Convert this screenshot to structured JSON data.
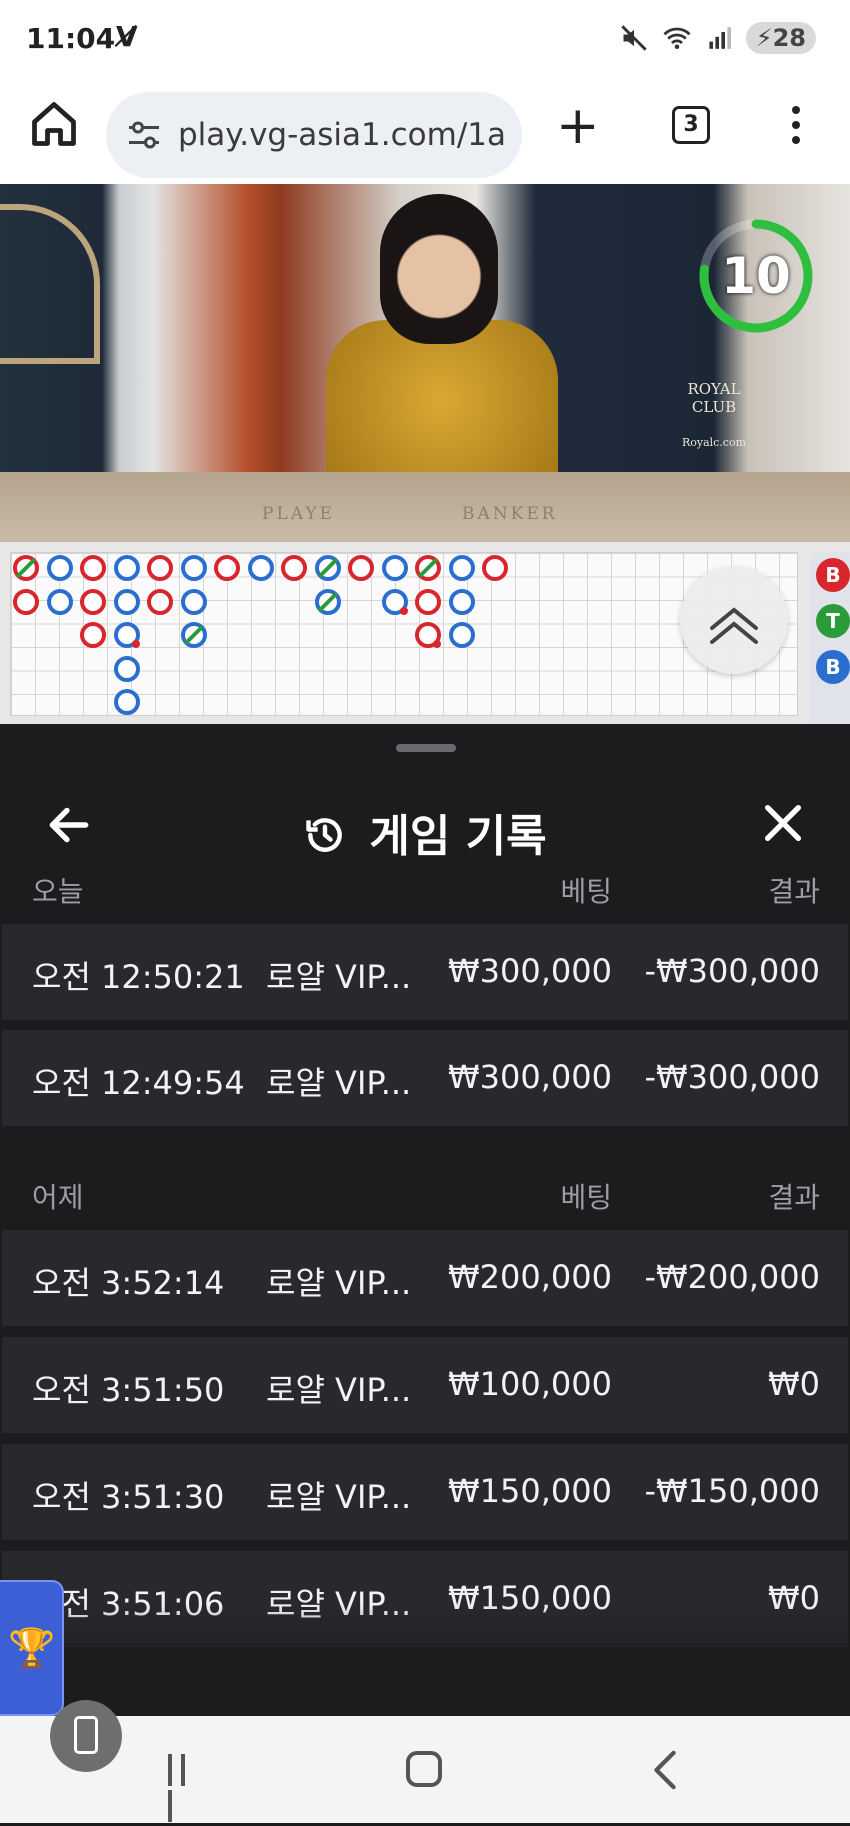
{
  "status_bar": {
    "time": "11:04",
    "battery": "28"
  },
  "browser": {
    "url": "play.vg-asia1.com/1a",
    "tab_count": "3"
  },
  "video": {
    "countdown": "10",
    "table_left_label": "PLAYE",
    "table_right_label": "BANKER",
    "brand": "ROYAL CLUB",
    "brand_site": "Royalc.com"
  },
  "side_strip": [
    "B",
    "T",
    "B"
  ],
  "sheet": {
    "title": "게임 기록",
    "sections": [
      {
        "label": "오늘",
        "bet_header": "베팅",
        "result_header": "결과",
        "rows": [
          {
            "time": "오전 12:50:21",
            "game": "로얄 VIP...",
            "bet": "₩300,000",
            "result": "-₩300,000"
          },
          {
            "time": "오전 12:49:54",
            "game": "로얄 VIP...",
            "bet": "₩300,000",
            "result": "-₩300,000"
          }
        ]
      },
      {
        "label": "어제",
        "bet_header": "베팅",
        "result_header": "결과",
        "rows": [
          {
            "time": "오전 3:52:14",
            "game": "로얄 VIP...",
            "bet": "₩200,000",
            "result": "-₩200,000"
          },
          {
            "time": "오전 3:51:50",
            "game": "로얄 VIP...",
            "bet": "₩100,000",
            "result": "₩0"
          },
          {
            "time": "오전 3:51:30",
            "game": "로얄 VIP...",
            "bet": "₩150,000",
            "result": "-₩150,000"
          },
          {
            "time": "오전 3:51:06",
            "game": "로얄 VIP...",
            "bet": "₩150,000",
            "result": "₩0"
          }
        ]
      }
    ]
  },
  "colors": {
    "banker_red": "#d9252c",
    "player_blue": "#2a6fd0",
    "tie_green": "#2a9a3a",
    "sheet_bg": "#1c1c1f",
    "row_bg": "#29292d"
  }
}
